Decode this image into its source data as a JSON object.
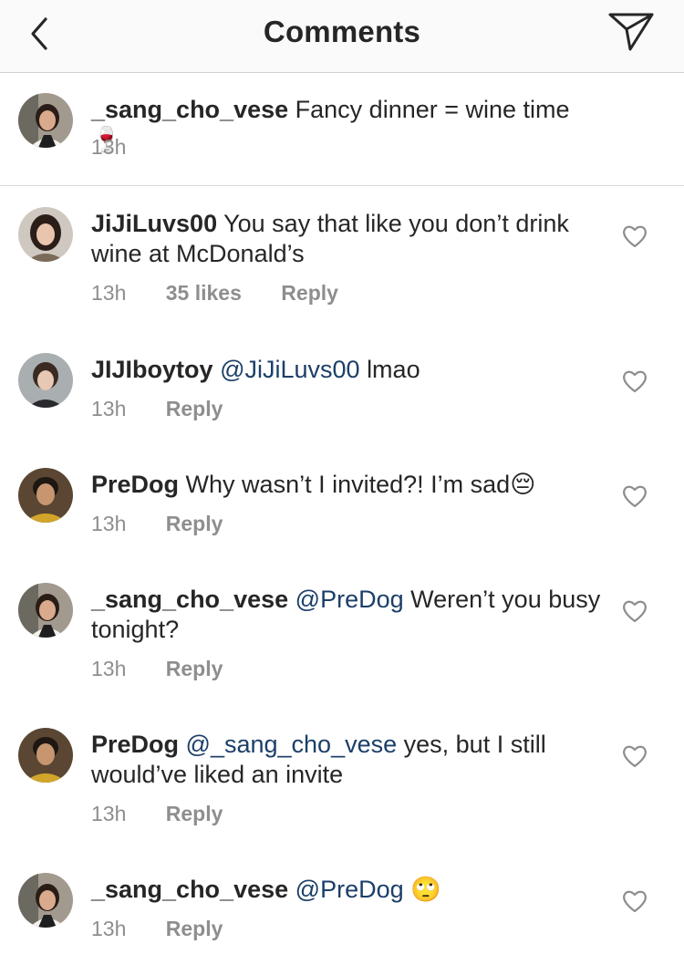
{
  "header": {
    "title": "Comments",
    "back_icon": "chevron-left-icon",
    "share_icon": "paper-plane-icon"
  },
  "caption": {
    "username": "_sang_cho_vese",
    "text": "Fancy dinner = wine time",
    "emoji": "🍷",
    "time": "13h"
  },
  "comments": [
    {
      "username": "JiJiLuvs00",
      "mention": "",
      "text": "You say that like you don’t drink wine at McDonald’s",
      "emoji": "",
      "time": "13h",
      "likes": "35 likes",
      "reply": "Reply"
    },
    {
      "username": "JIJIboytoy",
      "mention": "@JiJiLuvs00",
      "text": "lmao",
      "emoji": "",
      "time": "13h",
      "likes": "",
      "reply": "Reply"
    },
    {
      "username": "PreDog",
      "mention": "",
      "text": "Why wasn’t I invited?! I’m sad",
      "emoji": "😔",
      "time": "13h",
      "likes": "",
      "reply": "Reply"
    },
    {
      "username": "_sang_cho_vese",
      "mention": "@PreDog",
      "text": "Weren’t you busy tonight?",
      "emoji": "",
      "time": "13h",
      "likes": "",
      "reply": "Reply"
    },
    {
      "username": "PreDog",
      "mention": "@_sang_cho_vese",
      "text": "yes, but I still would’ve liked an invite",
      "emoji": "",
      "time": "13h",
      "likes": "",
      "reply": "Reply"
    },
    {
      "username": "_sang_cho_vese",
      "mention": "@PreDog",
      "text": "",
      "emoji": "🙄",
      "time": "13h",
      "likes": "",
      "reply": "Reply"
    }
  ],
  "colors": {
    "mention": "#1c3f68",
    "meta": "#8e8e8e",
    "text": "#262626",
    "header_bg": "#fafafa"
  }
}
